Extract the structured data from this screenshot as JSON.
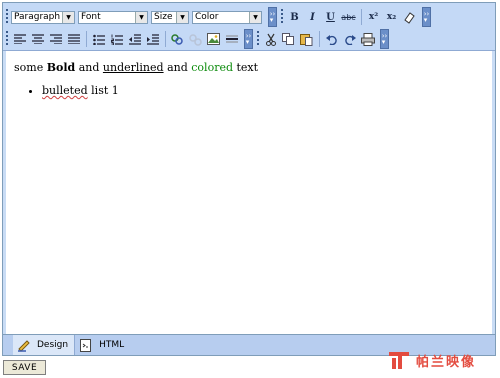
{
  "toolbar": {
    "row1": {
      "format_select": "Paragraph",
      "font_select": "Font",
      "size_select": "Size",
      "color_select": "Color",
      "bold_label": "B",
      "italic_label": "I",
      "underline_label": "U",
      "strike_label": "abc",
      "superscript_label": "x²",
      "subscript_label": "x₂"
    },
    "row2": {
      "icons": [
        "align-left-icon",
        "align-center-icon",
        "align-right-icon",
        "align-justify-icon",
        "unordered-list-icon",
        "ordered-list-icon",
        "outdent-icon",
        "indent-icon",
        "link-icon",
        "unlink-icon",
        "image-icon",
        "horizontal-rule-icon",
        "cut-icon",
        "copy-icon",
        "paste-icon",
        "undo-icon",
        "redo-icon",
        "print-icon"
      ]
    }
  },
  "content": {
    "line_prefix": "some ",
    "bold_word": "Bold",
    "and1": " and ",
    "underlined_word": "underlined",
    "and2": " and ",
    "colored_word": "colored",
    "suffix": " text",
    "list_item_word": "bulleted",
    "list_item_rest": " list 1"
  },
  "tabs": [
    {
      "label": "Design"
    },
    {
      "label": "HTML"
    }
  ],
  "save_label": "SAVE",
  "watermark": "帕兰映像",
  "colors": {
    "accent": "#c4d9f6",
    "green_text": "#0a8a0a",
    "watermark": "#e34b3f"
  }
}
